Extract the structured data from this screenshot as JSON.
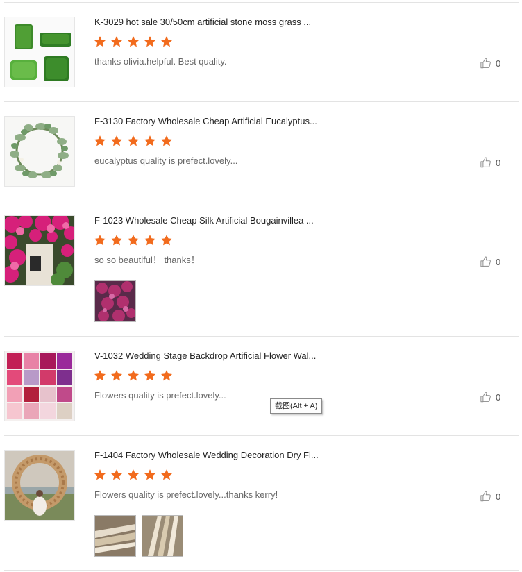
{
  "reviews": [
    {
      "title": "K-3029 hot sale 30/50cm artificial stone moss grass ...",
      "rating": 5,
      "comment": "thanks olivia.helpful. Best quality.",
      "likes": "0",
      "photo_count": 0
    },
    {
      "title": "F-3130 Factory Wholesale Cheap Artificial Eucalyptus...",
      "rating": 5,
      "comment": "eucalyptus quality is prefect.lovely...",
      "likes": "0",
      "photo_count": 0
    },
    {
      "title": "F-1023 Wholesale Cheap Silk Artificial Bougainvillea ...",
      "rating": 5,
      "comment": "so so beautiful！ thanks！",
      "likes": "0",
      "photo_count": 1
    },
    {
      "title": "V-1032 Wedding Stage Backdrop Artificial Flower Wal...",
      "rating": 5,
      "comment": "Flowers quality is prefect.lovely...",
      "likes": "0",
      "photo_count": 0
    },
    {
      "title": "F-1404 Factory Wholesale Wedding Decoration Dry Fl...",
      "rating": 5,
      "comment": "Flowers quality is prefect.lovely...thanks kerry!",
      "likes": "0",
      "photo_count": 2
    }
  ],
  "tooltip": {
    "text": "截图(Alt + A)"
  },
  "colors": {
    "star": "#f26b1d",
    "divider": "#e3e3e3",
    "comment_text": "#666666"
  },
  "icons": {
    "rating": "star-icon",
    "like": "thumbs-up-icon"
  }
}
